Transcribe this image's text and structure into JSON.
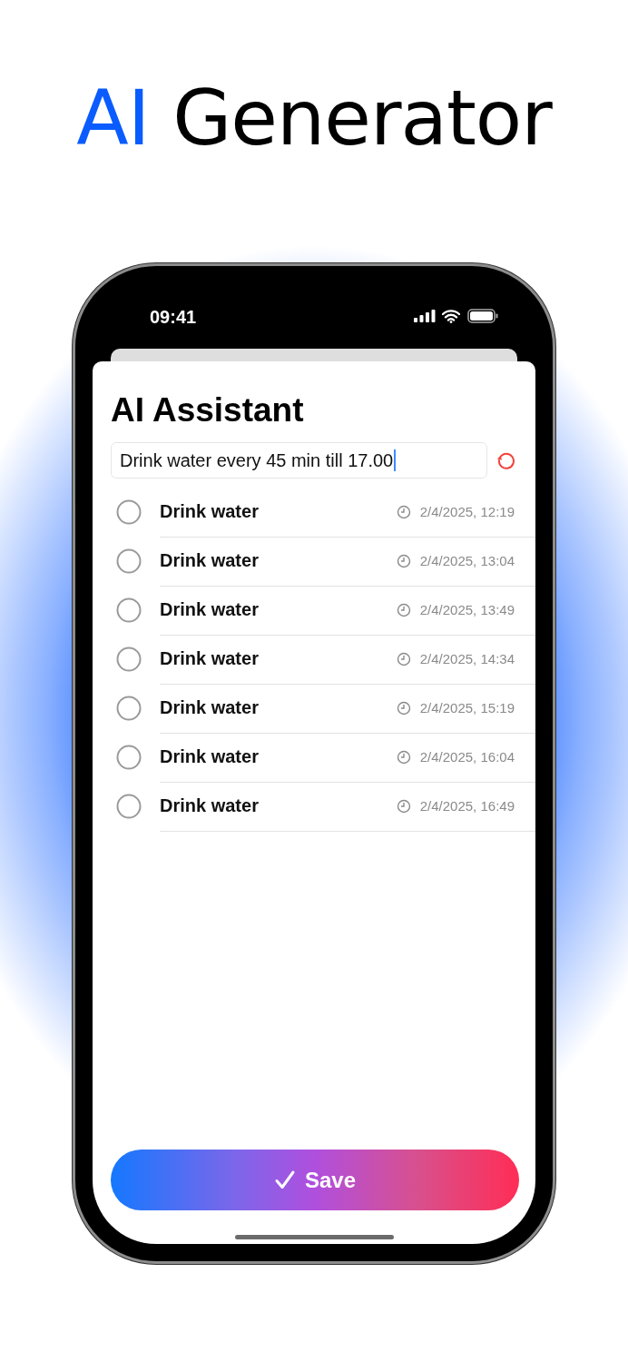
{
  "headline": {
    "accent": "AI",
    "text": "Generator"
  },
  "status_bar": {
    "time": "09:41"
  },
  "screen": {
    "title": "AI Assistant",
    "prompt": {
      "value": "Drink water every 45 min till 17.00",
      "focused": true
    },
    "tasks": [
      {
        "title": "Drink water",
        "time": "2/4/2025, 12:19",
        "checked": false
      },
      {
        "title": "Drink water",
        "time": "2/4/2025, 13:04",
        "checked": false
      },
      {
        "title": "Drink water",
        "time": "2/4/2025, 13:49",
        "checked": false
      },
      {
        "title": "Drink water",
        "time": "2/4/2025, 14:34",
        "checked": false
      },
      {
        "title": "Drink water",
        "time": "2/4/2025, 15:19",
        "checked": false
      },
      {
        "title": "Drink water",
        "time": "2/4/2025, 16:04",
        "checked": false
      },
      {
        "title": "Drink water",
        "time": "2/4/2025, 16:49",
        "checked": false
      }
    ],
    "save_button": "Save"
  }
}
